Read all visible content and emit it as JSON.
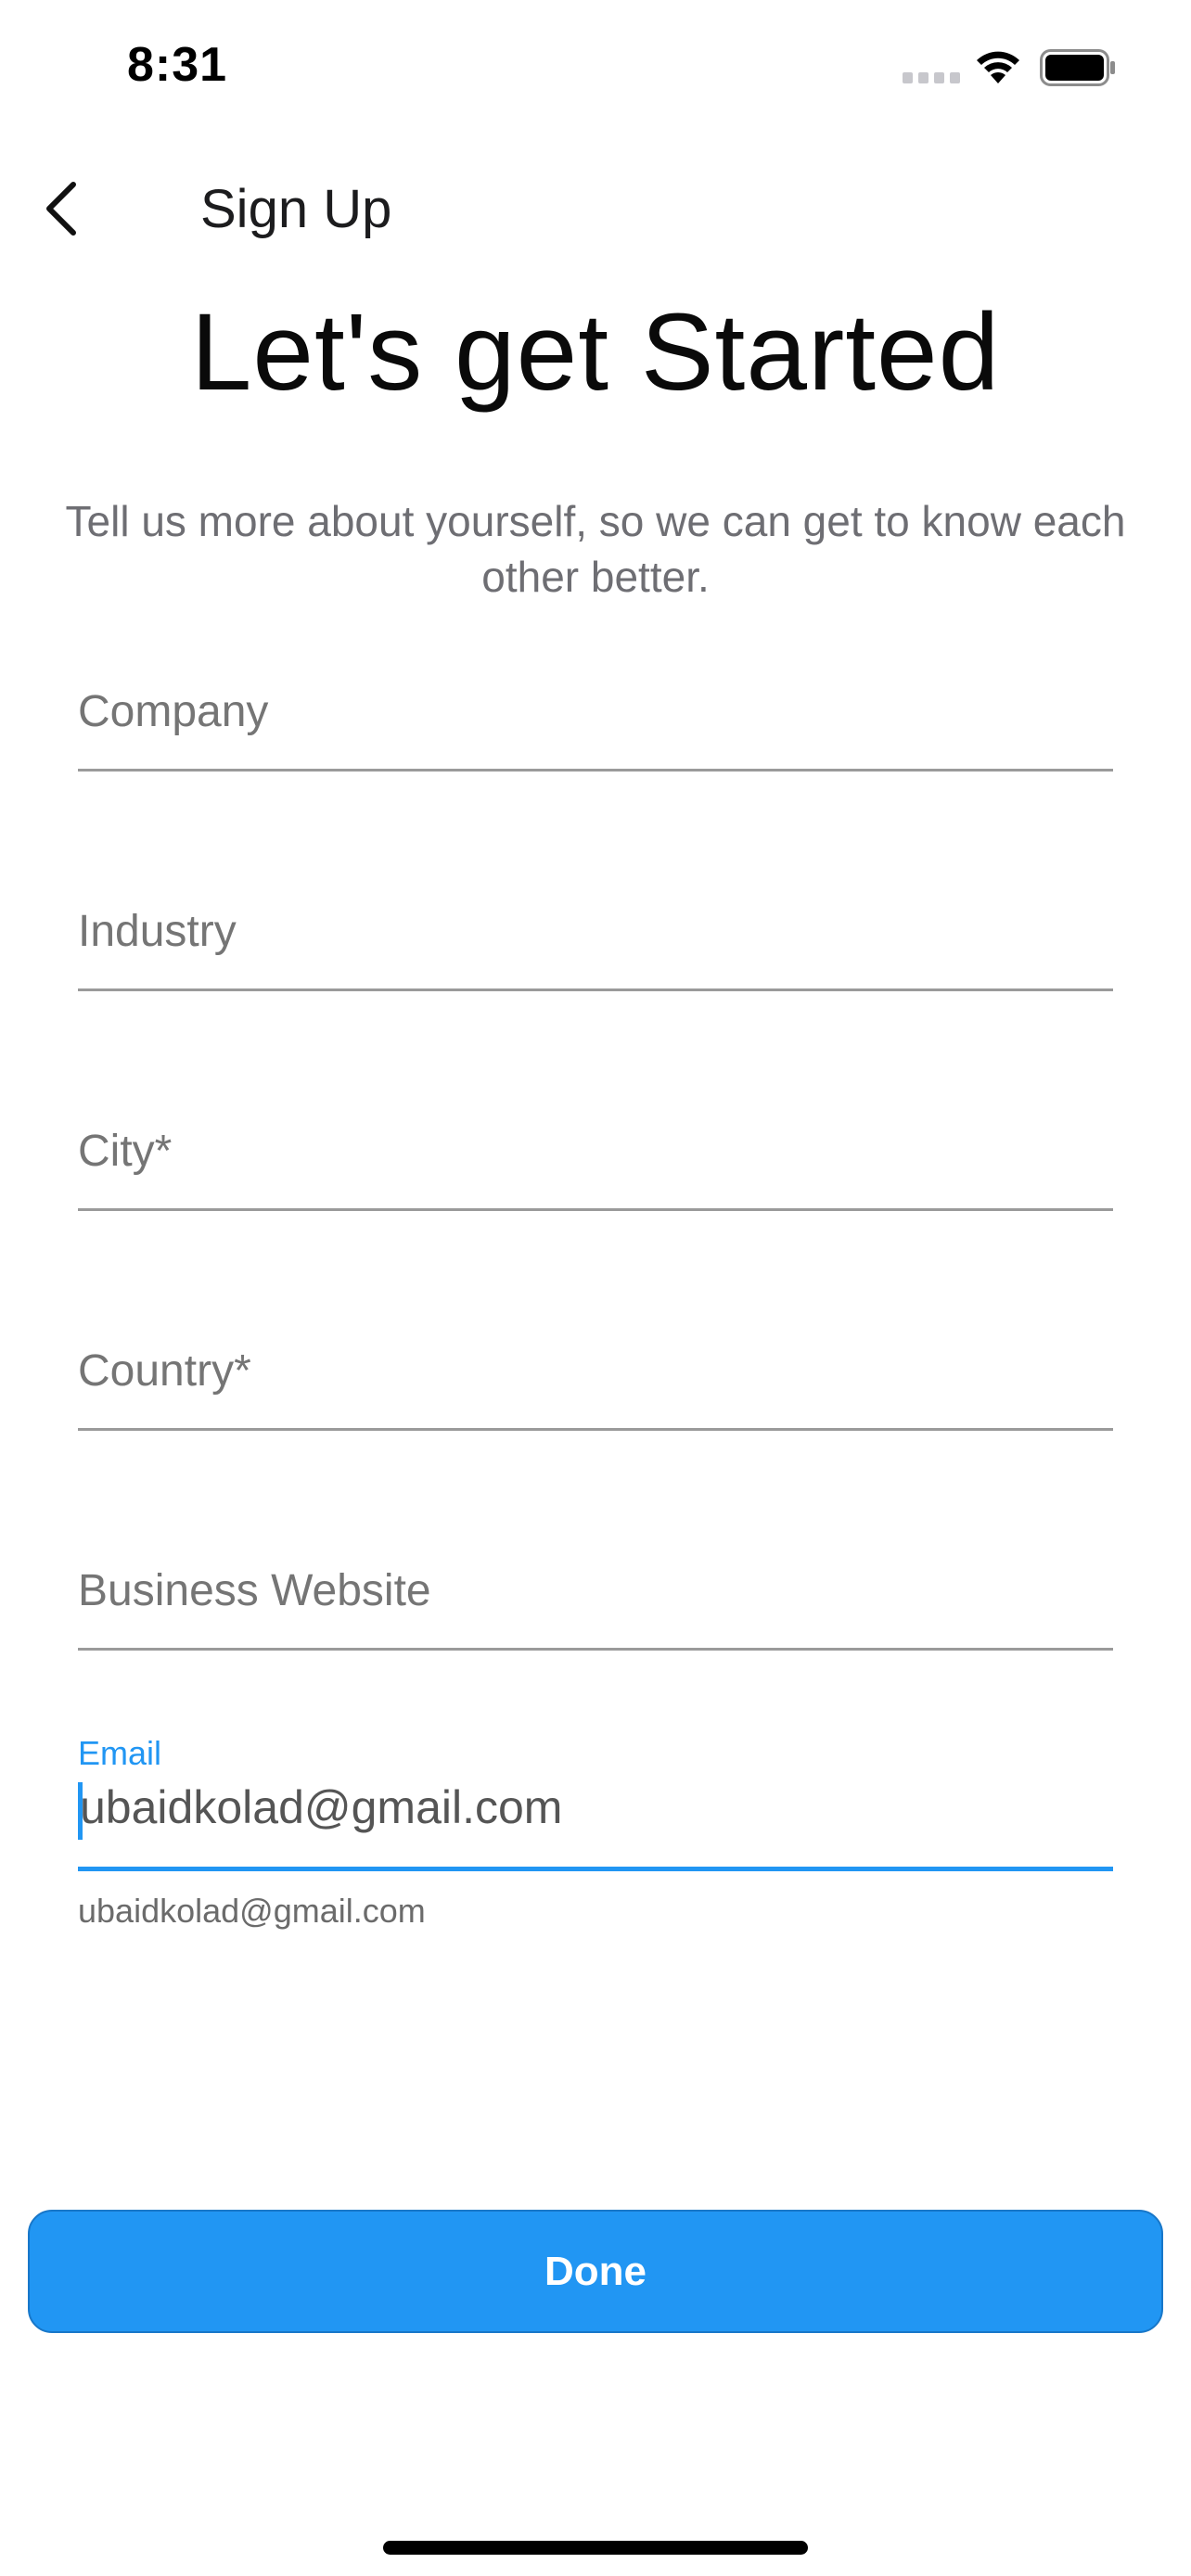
{
  "status_bar": {
    "time": "8:31",
    "icons": [
      "cellular-signal-icon",
      "wifi-icon",
      "battery-icon"
    ]
  },
  "nav": {
    "back_icon": "chevron-left-icon",
    "title": "Sign Up"
  },
  "header": {
    "headline": "Let's get Started",
    "subtitle": "Tell us more about yourself, so we can get to know each other better."
  },
  "form": {
    "company": {
      "placeholder": "Company",
      "value": ""
    },
    "industry": {
      "placeholder": "Industry",
      "value": ""
    },
    "city": {
      "placeholder": "City*",
      "value": ""
    },
    "country": {
      "placeholder": "Country*",
      "value": ""
    },
    "website": {
      "placeholder": "Business Website",
      "value": ""
    },
    "email": {
      "label": "Email",
      "value": "ubaidkolad@gmail.com",
      "helper": "ubaidkolad@gmail.com"
    }
  },
  "actions": {
    "done_label": "Done"
  },
  "colors": {
    "accent": "#2196f3",
    "text_primary": "#0a0a0a",
    "text_secondary": "#6e6e73",
    "divider": "#9a9a9a"
  }
}
